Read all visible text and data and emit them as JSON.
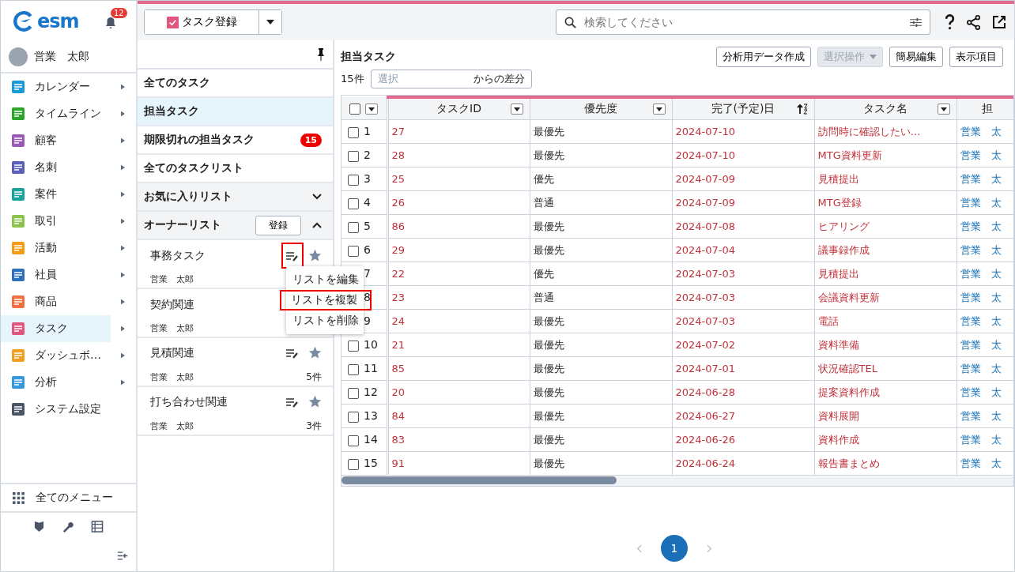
{
  "sidebar": {
    "logo": "esm",
    "notification_count": "12",
    "user": "営業　太郎",
    "nav": [
      {
        "label": "カレンダー",
        "selected": false,
        "submenu": true
      },
      {
        "label": "タイムライン",
        "selected": false,
        "submenu": true
      },
      {
        "label": "顧客",
        "selected": false,
        "submenu": true
      },
      {
        "label": "名刺",
        "selected": false,
        "submenu": true
      },
      {
        "label": "案件",
        "selected": false,
        "submenu": true
      },
      {
        "label": "取引",
        "selected": false,
        "submenu": true
      },
      {
        "label": "活動",
        "selected": false,
        "submenu": true
      },
      {
        "label": "社員",
        "selected": false,
        "submenu": true
      },
      {
        "label": "商品",
        "selected": false,
        "submenu": true
      },
      {
        "label": "タスク",
        "selected": true,
        "submenu": true
      },
      {
        "label": "ダッシュボ…",
        "selected": false,
        "submenu": true
      },
      {
        "label": "分析",
        "selected": false,
        "submenu": true
      },
      {
        "label": "システム設定",
        "selected": false,
        "submenu": false
      }
    ],
    "all_menu": "全てのメニュー"
  },
  "toolbar": {
    "register_button": "タスク登録",
    "search": {
      "placeholder": "検索してください"
    }
  },
  "list_panel": {
    "views": [
      {
        "label": "全てのタスク",
        "selected": false
      },
      {
        "label": "担当タスク",
        "selected": true
      },
      {
        "label": "期限切れの担当タスク",
        "selected": false,
        "badge": "15"
      },
      {
        "label": "全てのタスクリスト",
        "selected": false
      }
    ],
    "sections": [
      {
        "label": "お気に入りリスト",
        "expanded": false
      },
      {
        "label": "オーナーリスト",
        "expanded": true,
        "button": "登録"
      }
    ],
    "lists": [
      {
        "name": "事務タスク",
        "owner": "営業　太郎",
        "annotated": true
      },
      {
        "name": "契約関連",
        "owner": "営業　太郎",
        "annotated": false
      },
      {
        "name": "見積関連",
        "owner": "営業　太郎",
        "count": "5件",
        "annotated": false
      },
      {
        "name": "打ち合わせ関連",
        "owner": "営業　太郎",
        "count": "3件",
        "annotated": false
      }
    ],
    "context_menu": [
      {
        "label": "リストを編集",
        "annotated": false
      },
      {
        "label": "リストを複製",
        "annotated": true
      },
      {
        "label": "リストを削除",
        "annotated": false
      }
    ]
  },
  "main": {
    "title": "担当タスク",
    "buttons": [
      {
        "label": "分析用データ作成",
        "disabled": false,
        "dropdown": false
      },
      {
        "label": "選択操作",
        "disabled": true,
        "dropdown": true
      },
      {
        "label": "簡易編集",
        "disabled": false,
        "dropdown": false
      },
      {
        "label": "表示項目",
        "disabled": false,
        "dropdown": false
      }
    ],
    "count": "15件",
    "diff_field": {
      "placeholder": "選択",
      "suffix": "からの差分"
    },
    "table": {
      "header_checked": false,
      "columns": [
        {
          "label": "タスクID",
          "sorted": false
        },
        {
          "label": "優先度",
          "sorted": false
        },
        {
          "label": "完了(予定)日",
          "sorted": true
        },
        {
          "label": "タスク名",
          "sorted": false
        },
        {
          "label": "担"
        }
      ],
      "rows": [
        {
          "no": "1",
          "checked": false,
          "id": "27",
          "priority": "最優先",
          "date": "2024-07-10",
          "name": "訪問時に確認したい…",
          "owner": "営業　太"
        },
        {
          "no": "2",
          "checked": false,
          "id": "28",
          "priority": "最優先",
          "date": "2024-07-10",
          "name": "MTG資料更新",
          "owner": "営業　太"
        },
        {
          "no": "3",
          "checked": false,
          "id": "25",
          "priority": "優先",
          "date": "2024-07-09",
          "name": "見積提出",
          "owner": "営業　太"
        },
        {
          "no": "4",
          "checked": false,
          "id": "26",
          "priority": "普通",
          "date": "2024-07-09",
          "name": "MTG登録",
          "owner": "営業　太"
        },
        {
          "no": "5",
          "checked": false,
          "id": "86",
          "priority": "最優先",
          "date": "2024-07-08",
          "name": "ヒアリング",
          "owner": "営業　太"
        },
        {
          "no": "6",
          "checked": false,
          "id": "29",
          "priority": "最優先",
          "date": "2024-07-04",
          "name": "議事録作成",
          "owner": "営業　太"
        },
        {
          "no": "7",
          "id": "22",
          "priority": "優先",
          "date": "2024-07-03",
          "name": "見積提出",
          "owner": "営業　太"
        },
        {
          "no": "8",
          "id": "23",
          "priority": "普通",
          "date": "2024-07-03",
          "name": "会議資料更新",
          "owner": "営業　太"
        },
        {
          "no": "9",
          "id": "24",
          "priority": "最優先",
          "date": "2024-07-03",
          "name": "電話",
          "owner": "営業　太"
        },
        {
          "no": "10",
          "checked": false,
          "id": "21",
          "priority": "最優先",
          "date": "2024-07-02",
          "name": "資料準備",
          "owner": "営業　太"
        },
        {
          "no": "11",
          "checked": false,
          "id": "85",
          "priority": "最優先",
          "date": "2024-07-01",
          "name": "状況確認TEL",
          "owner": "営業　太"
        },
        {
          "no": "12",
          "checked": false,
          "id": "20",
          "priority": "最優先",
          "date": "2024-06-28",
          "name": "提案資料作成",
          "owner": "営業　太"
        },
        {
          "no": "13",
          "checked": false,
          "id": "84",
          "priority": "最優先",
          "date": "2024-06-27",
          "name": "資料展開",
          "owner": "営業　太"
        },
        {
          "no": "14",
          "checked": false,
          "id": "83",
          "priority": "最優先",
          "date": "2024-06-26",
          "name": "資料作成",
          "owner": "営業　太"
        },
        {
          "no": "15",
          "checked": false,
          "id": "91",
          "priority": "最優先",
          "date": "2024-06-24",
          "name": "報告書まとめ",
          "owner": "営業　太"
        }
      ]
    },
    "pagination": [
      {
        "label": "1",
        "selected": true
      }
    ]
  }
}
